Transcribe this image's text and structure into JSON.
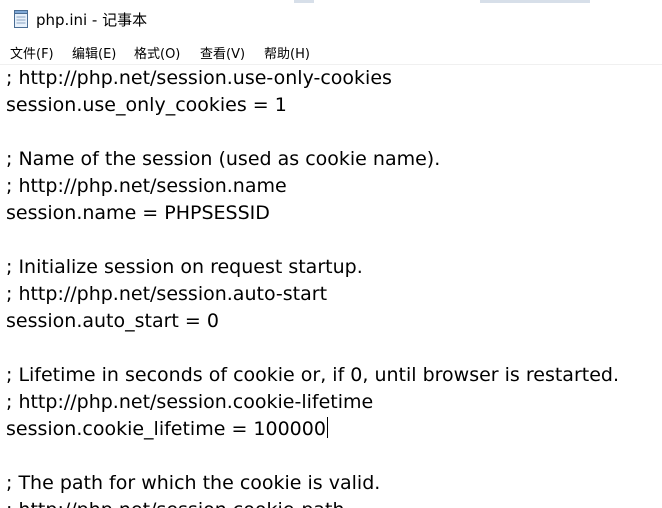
{
  "window": {
    "title": "php.ini - 记事本",
    "icon": "notepad-icon"
  },
  "menu": {
    "items": [
      {
        "label": "文件(F)"
      },
      {
        "label": "编辑(E)"
      },
      {
        "label": "格式(O)"
      },
      {
        "label": "查看(V)"
      },
      {
        "label": "帮助(H)"
      }
    ]
  },
  "editor": {
    "lines": [
      "; http://php.net/session.use-only-cookies",
      "session.use_only_cookies = 1",
      "",
      "; Name of the session (used as cookie name).",
      "; http://php.net/session.name",
      "session.name = PHPSESSID",
      "",
      "; Initialize session on request startup.",
      "; http://php.net/session.auto-start",
      "session.auto_start = 0",
      "",
      "; Lifetime in seconds of cookie or, if 0, until browser is restarted.",
      "; http://php.net/session.cookie-lifetime",
      "session.cookie_lifetime = 100000",
      "",
      "; The path for which the cookie is valid.",
      "; http://php.net/session.cookie-path"
    ],
    "caret_line": 13
  }
}
